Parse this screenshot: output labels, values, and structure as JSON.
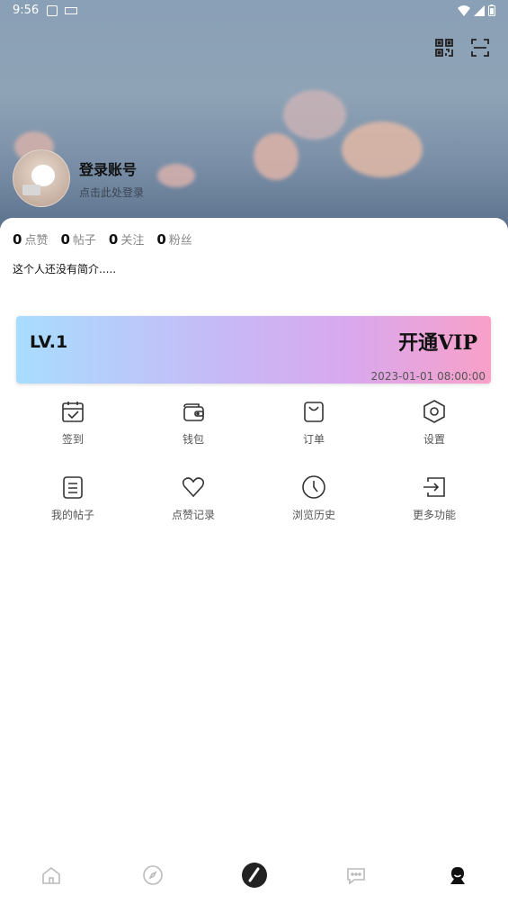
{
  "status": {
    "time": "9:56"
  },
  "profile": {
    "name": "登录账号",
    "subtitle": "点击此处登录"
  },
  "stats": [
    {
      "count": "0",
      "label": "点赞"
    },
    {
      "count": "0",
      "label": "帖子"
    },
    {
      "count": "0",
      "label": "关注"
    },
    {
      "count": "0",
      "label": "粉丝"
    }
  ],
  "bio": "这个人还没有简介.....",
  "vip": {
    "level": "LV.1",
    "cta": "开通VIP",
    "date": "2023-01-01 08:00:00"
  },
  "menu": [
    {
      "label": "签到",
      "icon": "calendar-check-icon"
    },
    {
      "label": "钱包",
      "icon": "wallet-icon"
    },
    {
      "label": "订单",
      "icon": "shopping-bag-icon"
    },
    {
      "label": "设置",
      "icon": "settings-hexagon-icon"
    },
    {
      "label": "我的帖子",
      "icon": "document-list-icon"
    },
    {
      "label": "点赞记录",
      "icon": "heart-icon"
    },
    {
      "label": "浏览历史",
      "icon": "clock-icon"
    },
    {
      "label": "更多功能",
      "icon": "exit-arrow-icon"
    }
  ],
  "nav": [
    "home-icon",
    "compass-icon",
    "pen-icon",
    "chat-bubble-icon",
    "profile-icon"
  ]
}
